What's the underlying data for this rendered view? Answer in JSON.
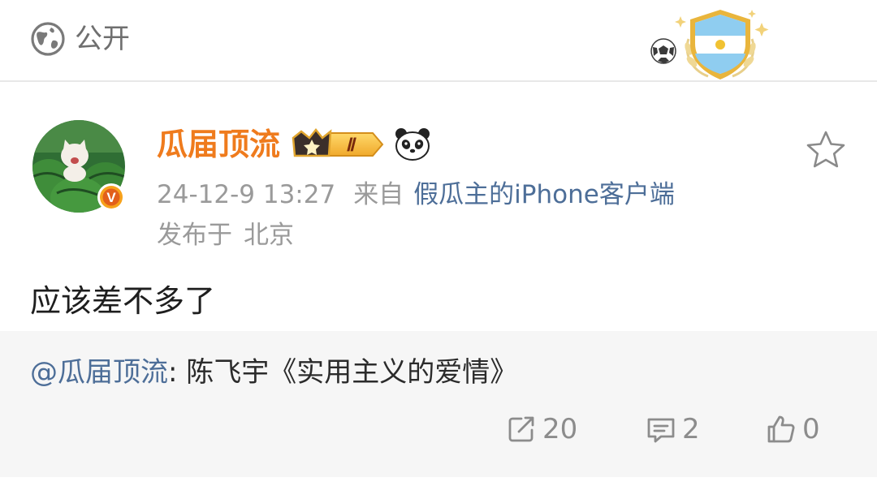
{
  "visibility": {
    "icon": "globe-icon",
    "label": "公开"
  },
  "badge": {
    "icon": "football-shield-badge"
  },
  "post": {
    "author": "瓜届顶流",
    "member_level": "Ⅱ",
    "verified_mark": "V",
    "time": "24-12-9 13:27",
    "from_prefix": "来自",
    "client": "假瓜主的iPhone客户端",
    "location_prefix": "发布于",
    "location": "北京",
    "text": "应该差不多了"
  },
  "repost": {
    "mention": "@瓜届顶流",
    "separator": ": ",
    "content": "陈飞宇《实用主义的爱情》"
  },
  "actions": {
    "repost_count": "20",
    "comment_count": "2",
    "like_count": "0"
  },
  "colors": {
    "author_name": "#ef7b1d",
    "link": "#4d6e98",
    "meta": "#9a9a9a",
    "repost_bg": "#f6f6f6"
  }
}
